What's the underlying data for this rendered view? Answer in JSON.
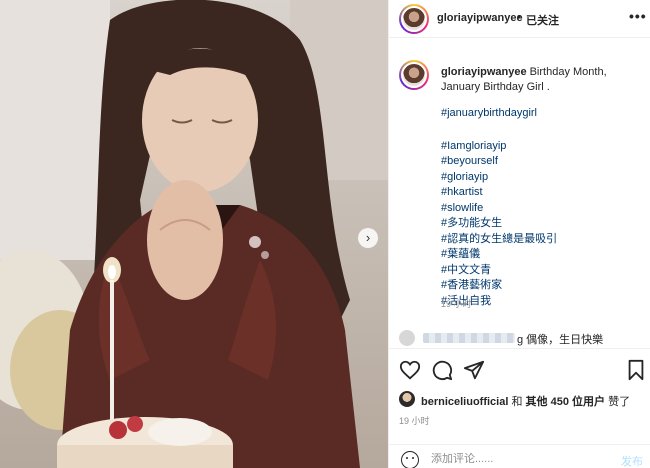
{
  "post": {
    "author": "gloriayipwanyee",
    "follow_status": "已关注",
    "dot": "•",
    "more": "•••",
    "caption_lines": [
      "Birthday Month,",
      "January Birthday Girl ."
    ],
    "hashtags": [
      "#januarybirthdaygirl",
      "#Iamgloriayip",
      "#beyourself",
      "#gloriayip",
      "#hkartist",
      "#slowlife",
      "#多功能女生",
      "#認真的女生總是最吸引",
      "#葉蘊儀",
      "#中文文青",
      "#香港藝術家",
      "#活出自我"
    ],
    "caption_time": "19 小时"
  },
  "comment_preview": {
    "text": "g 偶像，生日快樂"
  },
  "likes": {
    "user": "berniceliuofficial",
    "connector": "和",
    "others": "其他 450 位用户",
    "suffix": "赞了"
  },
  "post_time": "19 小时",
  "comment_box": {
    "placeholder": "添加评论......",
    "post_label": "发布"
  },
  "icons": {
    "like": "heart-icon",
    "comment": "comment-bubble-icon",
    "share": "paper-plane-icon",
    "save": "bookmark-icon",
    "emoji": "smiley-icon",
    "carousel_next": "chevron-right-icon",
    "more": "more-dots-icon"
  },
  "colors": {
    "hashtag": "#00376b",
    "muted": "#8e8e8e",
    "post_disabled": "#b2dffc",
    "divider": "#efefef"
  }
}
